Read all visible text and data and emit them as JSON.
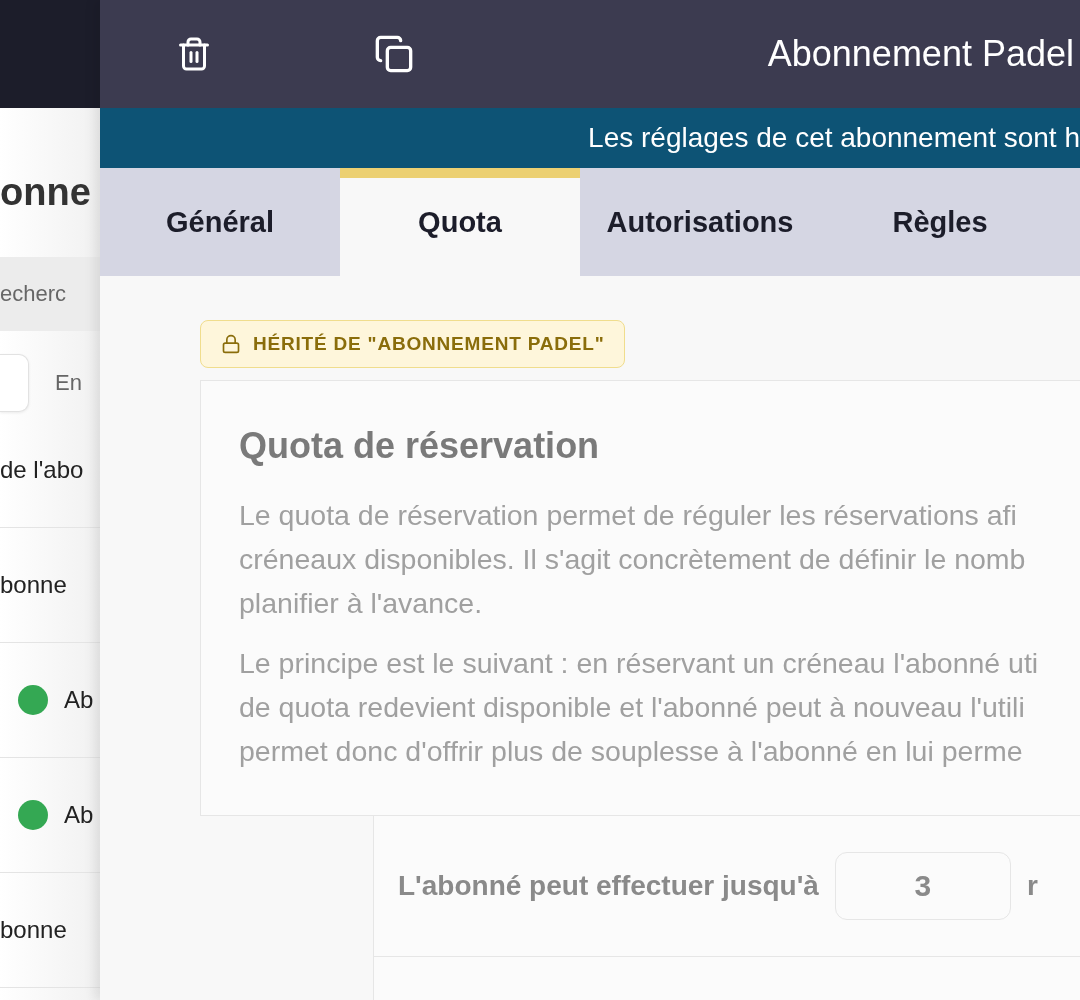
{
  "background_page": {
    "title": "onne",
    "search": {
      "placeholder": "echerc"
    },
    "filter_label": "En",
    "rows": [
      {
        "kind": "text",
        "label": "de l'abo"
      },
      {
        "kind": "text",
        "label": "bonne"
      },
      {
        "kind": "status",
        "label": "Ab",
        "color": "#34a853"
      },
      {
        "kind": "status",
        "label": "Ab",
        "color": "#34a853"
      },
      {
        "kind": "text",
        "label": "bonne"
      }
    ]
  },
  "drawer": {
    "title": "Abonnement Padel",
    "banner": "Les réglages de cet abonnement sont h",
    "tabs": [
      {
        "label": "Général",
        "selected": false
      },
      {
        "label": "Quota",
        "selected": true
      },
      {
        "label": "Autorisations",
        "selected": false
      },
      {
        "label": "Règles",
        "selected": false
      }
    ],
    "inherited_badge": "HÉRITÉ DE \"ABONNEMENT PADEL\"",
    "card": {
      "title": "Quota de réservation",
      "paragraphs": [
        [
          "Le quota de réservation permet de réguler les réservations afi",
          "créneaux disponibles. Il s'agit concrètement de définir le nomb",
          "planifier à l'avance."
        ],
        [
          "Le principe est le suivant : en réservant un créneau l'abonné uti",
          "de quota redevient disponible et l'abonné peut à nouveau l'utili",
          "permet donc d'offrir plus de souplesse à l'abonné en lui perme"
        ]
      ]
    },
    "quota_row": {
      "label": "L'abonné peut effectuer jusqu'à",
      "value": "3",
      "suffix": "r"
    }
  }
}
